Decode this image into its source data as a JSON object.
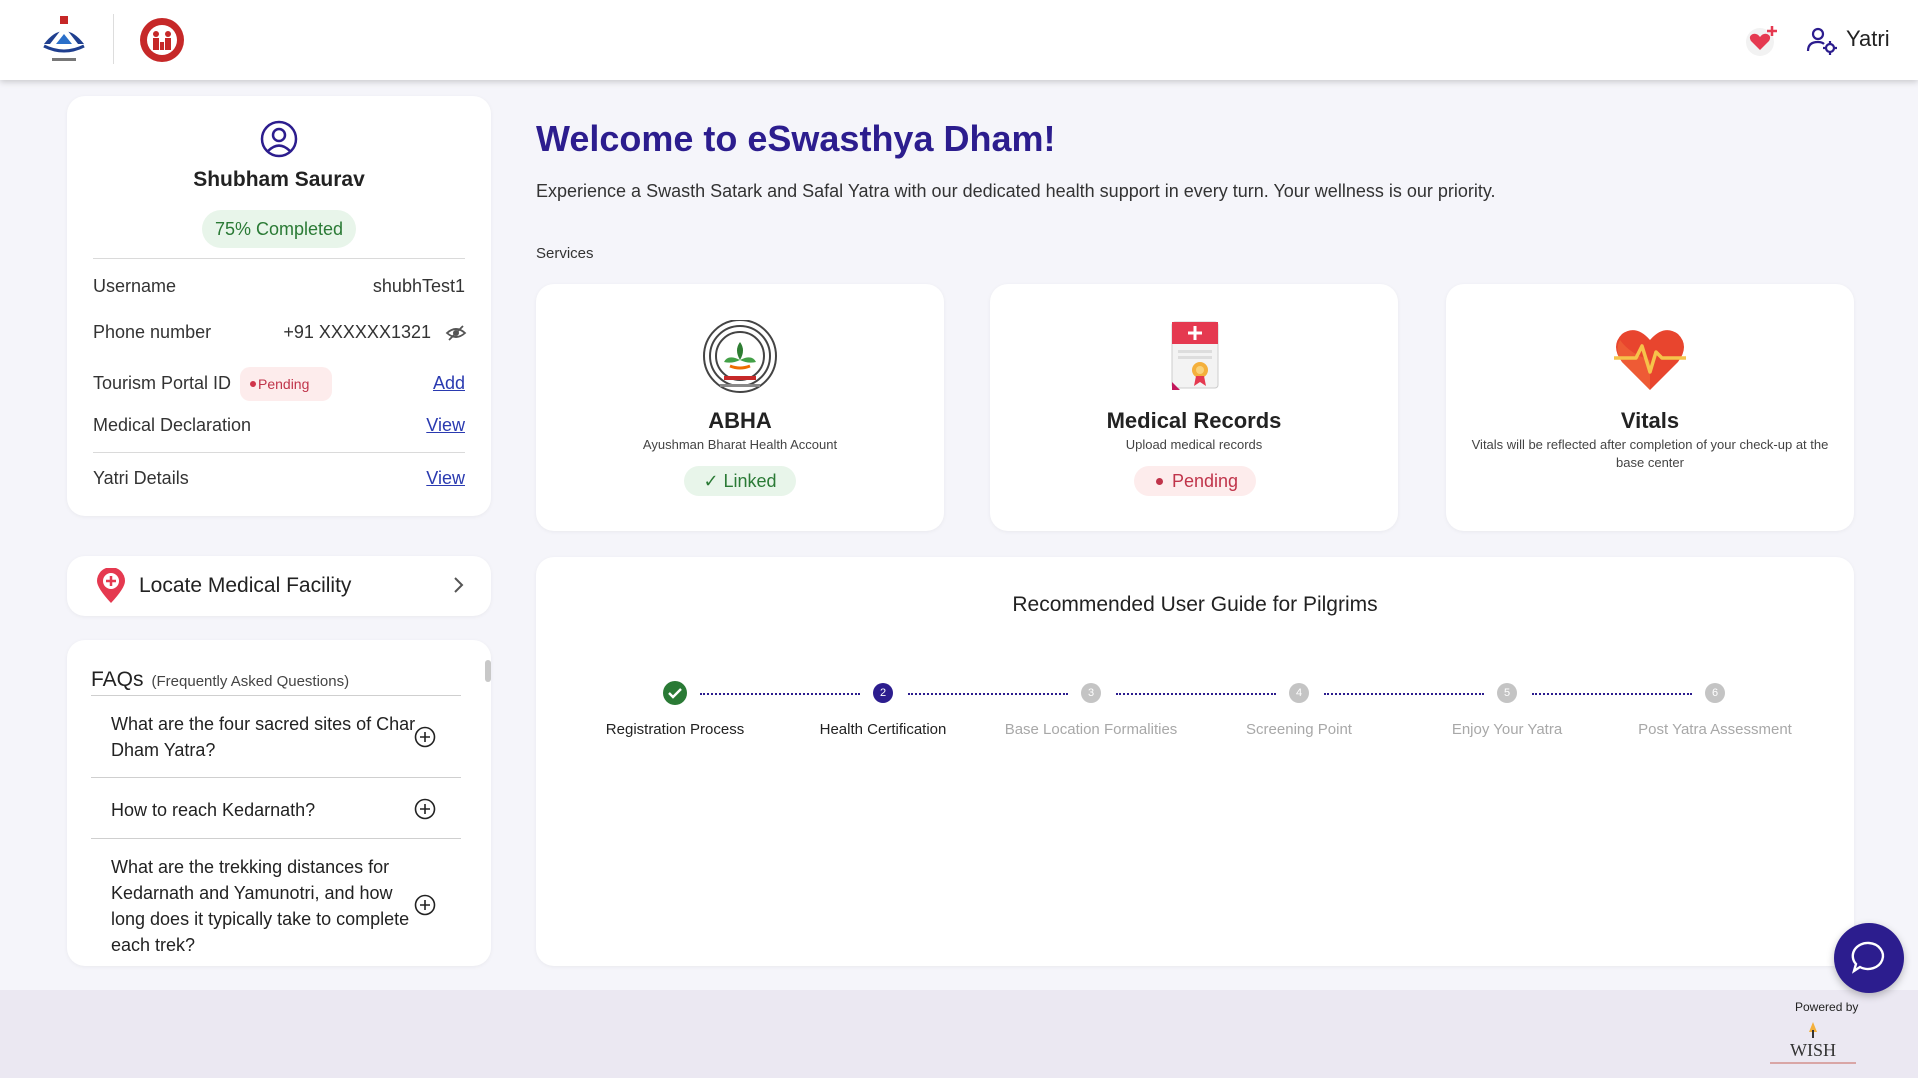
{
  "header": {
    "user_label": "Yatri",
    "icons": [
      "uttarakhand-logo",
      "nhm-logo",
      "heart-plus-icon",
      "user-gear-icon"
    ]
  },
  "profile": {
    "name": "Shubham Saurav",
    "completion": "75% Completed",
    "rows": {
      "username_label": "Username",
      "username_value": "shubhTest1",
      "phone_label": "Phone number",
      "phone_value": "+91 XXXXXX1321",
      "tourism_label": "Tourism Portal ID",
      "tourism_status": "Pending",
      "tourism_action": "Add",
      "medical_label": "Medical Declaration",
      "medical_action": "View",
      "yatri_label": "Yatri Details",
      "yatri_action": "View"
    }
  },
  "locate": {
    "label": "Locate Medical Facility"
  },
  "faq": {
    "title": "FAQs",
    "subtitle": "(Frequently Asked Questions)",
    "items": [
      "What are the four sacred sites of Char Dham Yatra?",
      "How to reach Kedarnath?",
      "What are the trekking distances for Kedarnath and Yamunotri, and how long does it typically take to complete each trek?"
    ]
  },
  "main": {
    "welcome": "Welcome to eSwasthya Dham!",
    "subtitle": "Experience a Swasth Satark and Safal Yatra with our dedicated health support in every turn. Your wellness is our priority.",
    "services_label": "Services"
  },
  "services": [
    {
      "title": "ABHA",
      "subtitle": "Ayushman Bharat Health Account",
      "status": "✓ Linked"
    },
    {
      "title": "Medical Records",
      "subtitle": "Upload medical records",
      "status": "Pending"
    },
    {
      "title": "Vitals",
      "subtitle": "Vitals will be reflected after completion of your check-up at the base center",
      "status": ""
    }
  ],
  "guide": {
    "title": "Recommended User Guide for Pilgrims",
    "steps": [
      {
        "label": "Registration Process",
        "number": "",
        "state": "done"
      },
      {
        "label": "Health Certification",
        "number": "2",
        "state": "active"
      },
      {
        "label": "Base Location Formalities",
        "number": "3",
        "state": "upcoming"
      },
      {
        "label": "Screening Point",
        "number": "4",
        "state": "upcoming"
      },
      {
        "label": "Enjoy Your Yatra",
        "number": "5",
        "state": "upcoming"
      },
      {
        "label": "Post Yatra Assessment",
        "number": "6",
        "state": "upcoming"
      }
    ]
  },
  "footer": {
    "powered_by": "Powered by",
    "brand": "WISH"
  },
  "colors": {
    "primary": "#2c1d8e",
    "success": "#2a7a35",
    "danger": "#c0344a"
  }
}
